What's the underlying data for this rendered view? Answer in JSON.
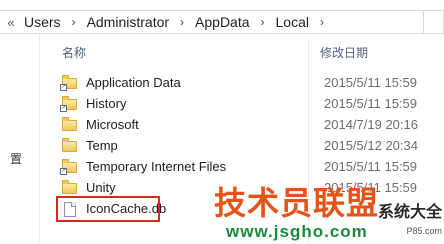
{
  "address_bar": {
    "overflow_glyph": "«",
    "separator": "›",
    "crumbs": [
      "Users",
      "Administrator",
      "AppData",
      "Local"
    ],
    "dropdown_glyph": "▾"
  },
  "nav_pane": {
    "glyph": "置"
  },
  "columns": {
    "name": "名称",
    "date_modified": "修改日期"
  },
  "rows": [
    {
      "name": "Application Data",
      "date": "2015/5/11 15:59",
      "icon": "folder-shortcut-icon"
    },
    {
      "name": "History",
      "date": "2015/5/11 15:59",
      "icon": "folder-shortcut-icon"
    },
    {
      "name": "Microsoft",
      "date": "2014/7/19 20:16",
      "icon": "folder-icon"
    },
    {
      "name": "Temp",
      "date": "2015/5/12 20:34",
      "icon": "folder-icon"
    },
    {
      "name": "Temporary Internet Files",
      "date": "2015/5/11 15:59",
      "icon": "folder-shortcut-icon"
    },
    {
      "name": "Unity",
      "date": "2015/5/11 15:59",
      "icon": "folder-icon"
    },
    {
      "name": "IconCache.db",
      "date": "",
      "icon": "file-icon"
    }
  ],
  "highlight_color": "#d9281e",
  "watermark": {
    "main": "技术员联盟",
    "sub": "系统大全",
    "url": "www.jsgho.com",
    "small": "P85.com"
  }
}
